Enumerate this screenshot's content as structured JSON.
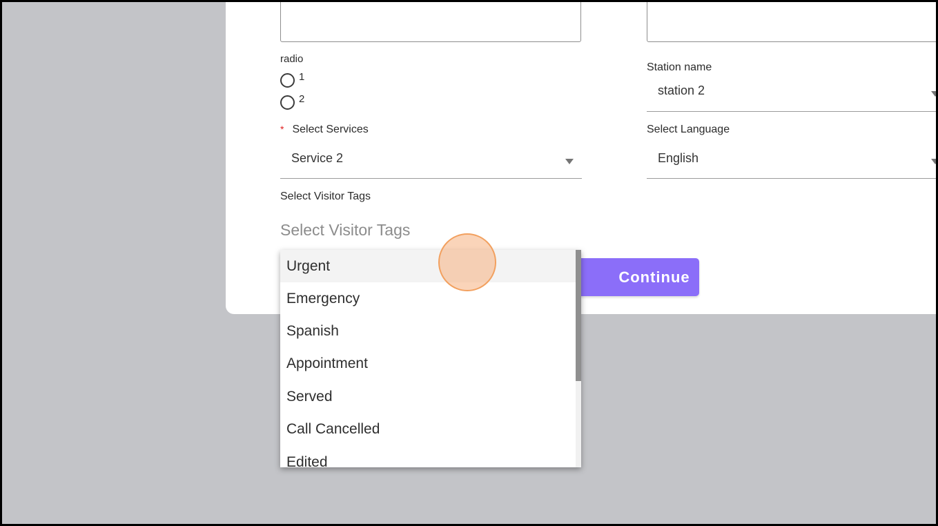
{
  "form": {
    "radio_label": "radio",
    "radio_options": [
      "1",
      "2"
    ],
    "services_required_mark": "*",
    "services_label": "Select Services",
    "services_value": "Service 2",
    "visitor_tags_label": "Select Visitor Tags",
    "visitor_tags_placeholder": "Select Visitor Tags",
    "station_label": "Station name",
    "station_value": "station 2",
    "language_label": "Select Language",
    "language_value": "English",
    "continue_label": "Continue"
  },
  "dropdown": {
    "options": [
      "Urgent",
      "Emergency",
      "Spanish",
      "Appointment",
      "Served",
      "Call Cancelled",
      "Edited"
    ],
    "hovered_option": "Urgent"
  },
  "colors": {
    "accent": "#8b6ef9",
    "required": "#e02020",
    "backdrop": "#c3c4c8",
    "click_indicator": "#f2a05f"
  }
}
